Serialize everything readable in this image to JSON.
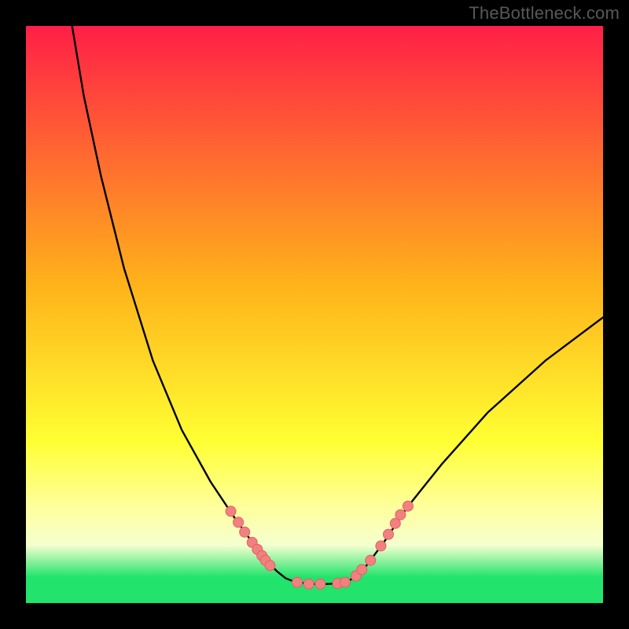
{
  "watermark": "TheBottleneck.com",
  "colors": {
    "bg_black": "#000000",
    "top_red": "#ff1f47",
    "mid_orange": "#ffb31a",
    "yellow": "#ffff33",
    "pale_yellow": "#ffff99",
    "off_white": "#f5ffd0",
    "green": "#22e36b",
    "curve": "#000000",
    "dot_fill": "#f28080",
    "dot_stroke": "#e06262"
  },
  "chart_data": {
    "type": "line",
    "title": "",
    "xlabel": "",
    "ylabel": "",
    "xlim": [
      0,
      100
    ],
    "ylim": [
      0,
      100
    ],
    "grid": false,
    "legend": false,
    "gradient_stops": [
      {
        "offset": 0.0,
        "color_key": "top_red"
      },
      {
        "offset": 0.45,
        "color_key": "mid_orange"
      },
      {
        "offset": 0.72,
        "color_key": "yellow"
      },
      {
        "offset": 0.83,
        "color_key": "pale_yellow"
      },
      {
        "offset": 0.9,
        "color_key": "off_white"
      },
      {
        "offset": 0.955,
        "color_key": "green"
      },
      {
        "offset": 1.0,
        "color_key": "green"
      }
    ],
    "series": [
      {
        "name": "left-branch",
        "x": [
          8,
          10,
          13,
          17,
          22,
          27,
          32,
          36,
          38.5,
          40.5,
          42,
          43.5,
          45,
          46.5,
          48.5
        ],
        "y": [
          100,
          88,
          74,
          58,
          42,
          30,
          21,
          15,
          11.5,
          9,
          7,
          5.5,
          4.3,
          3.7,
          3.4
        ]
      },
      {
        "name": "valley-floor",
        "x": [
          48.5,
          50,
          52,
          54,
          55.5
        ],
        "y": [
          3.4,
          3.3,
          3.3,
          3.4,
          3.6
        ]
      },
      {
        "name": "right-branch",
        "x": [
          55.5,
          57,
          59,
          62,
          66,
          72,
          80,
          90,
          100
        ],
        "y": [
          3.6,
          4.5,
          6.5,
          10.5,
          16.5,
          24,
          33,
          42,
          49.5
        ]
      }
    ],
    "scatter": {
      "name": "highlighted-points",
      "x": [
        35.5,
        36.8,
        37.9,
        39.2,
        40.1,
        40.9,
        41.5,
        42.3,
        47.0,
        49.0,
        51.0,
        54.0,
        55.3,
        57.2,
        58.2,
        59.7,
        61.5,
        62.8,
        64.0,
        64.9,
        66.2
      ],
      "y": [
        15.9,
        14.0,
        12.3,
        10.5,
        9.3,
        8.2,
        7.4,
        6.5,
        3.6,
        3.3,
        3.3,
        3.4,
        3.6,
        4.7,
        5.8,
        7.4,
        9.9,
        11.9,
        13.8,
        15.3,
        16.8
      ]
    }
  }
}
